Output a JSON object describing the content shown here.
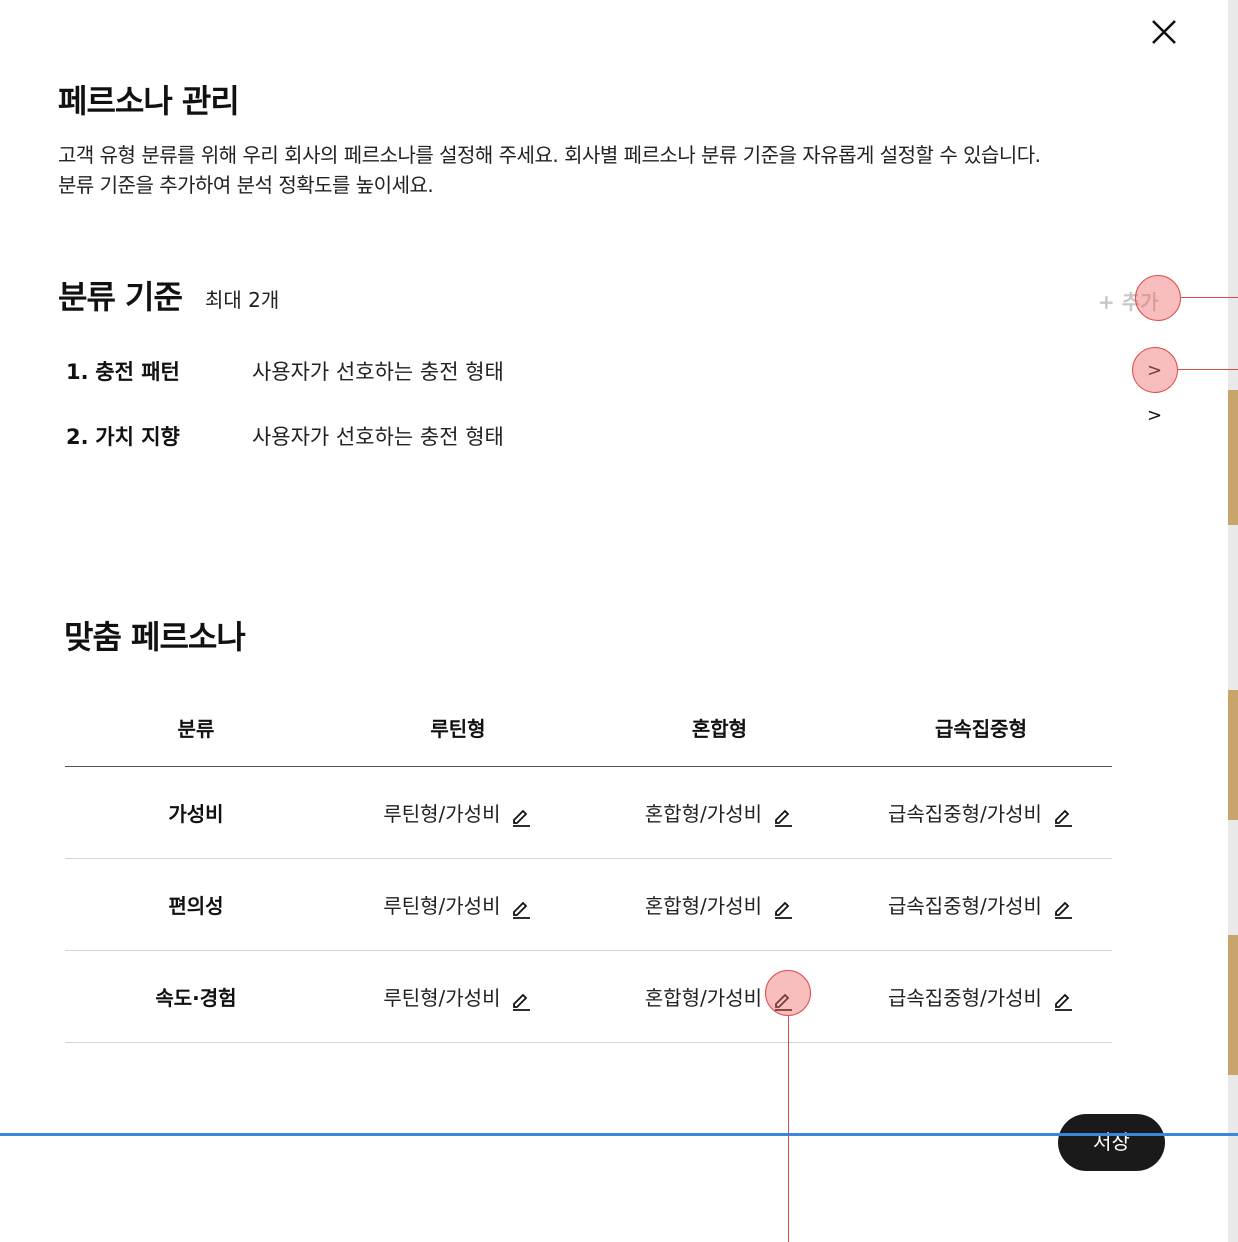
{
  "modal": {
    "title": "페르소나 관리",
    "description_line1": "고객 유형 분류를 위해 우리 회사의 페르소나를 설정해 주세요. 회사별 페르소나 분류 기준을 자유롭게 설정할 수 있습니다.",
    "description_line2": "분류 기준을 추가하여 분석 정확도를 높이세요.",
    "close_icon": "close-icon"
  },
  "criteria": {
    "title": "분류 기준",
    "limit": "최대 2개",
    "add_label": "+ 추가",
    "items": [
      {
        "num": "1.",
        "name": "충전 패턴",
        "desc": "사용자가 선호하는 충전 형태",
        "chevron": ">"
      },
      {
        "num": "2.",
        "name": "가치 지향",
        "desc": "사용자가 선호하는 충전 형태",
        "chevron": ">"
      }
    ]
  },
  "personas": {
    "title": "맞춤 페르소나",
    "columns": [
      "분류",
      "루틴형",
      "혼합형",
      "급속집중형"
    ],
    "rows": [
      {
        "label": "가성비",
        "cells": [
          "루틴형/가성비",
          "혼합형/가성비",
          "급속집중형/가성비"
        ]
      },
      {
        "label": "편의성",
        "cells": [
          "루틴형/가성비",
          "혼합형/가성비",
          "급속집중형/가성비"
        ]
      },
      {
        "label": "속도·경험",
        "cells": [
          "루틴형/가성비",
          "혼합형/가성비",
          "급속집중형/가성비"
        ]
      }
    ],
    "edit_icon": "pencil-icon"
  },
  "footer": {
    "save_label": "저장"
  },
  "colors": {
    "primary_dark": "#1a1a1a",
    "disabled": "#c7c7c7",
    "highlight": "#e24a4a",
    "guide": "#3b86df"
  }
}
